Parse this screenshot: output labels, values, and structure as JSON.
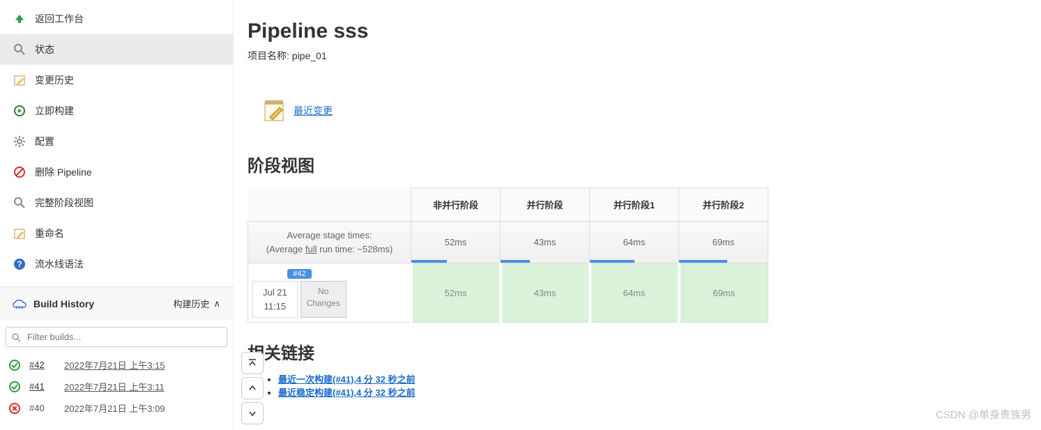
{
  "sidebar": {
    "items": [
      {
        "label": "返回工作台"
      },
      {
        "label": "状态"
      },
      {
        "label": "变更历史"
      },
      {
        "label": "立即构建"
      },
      {
        "label": "配置"
      },
      {
        "label": "删除 Pipeline"
      },
      {
        "label": "完整阶段视图"
      },
      {
        "label": "重命名"
      },
      {
        "label": "流水线语法"
      }
    ]
  },
  "buildHistory": {
    "title": "Build History",
    "trendLabel": "构建历史",
    "filterPlaceholder": "Filter builds...",
    "builds": [
      {
        "status": "success",
        "num": "#42",
        "date": "2022年7月21日 上午3:15"
      },
      {
        "status": "success",
        "num": "#41",
        "date": "2022年7月21日 上午3:11"
      },
      {
        "status": "fail",
        "num": "#40",
        "date": "2022年7月21日 上午3:09"
      }
    ]
  },
  "page": {
    "title": "Pipeline sss",
    "projectLabel": "项目名称: pipe_01",
    "recentChange": "最近变更",
    "stageTitle": "阶段视图",
    "relatedTitle": "相关链接"
  },
  "stages": {
    "headers": [
      "非并行阶段",
      "并行阶段",
      "并行阶段1",
      "并行阶段2"
    ],
    "avgLabel": "Average stage times:",
    "avgSub1": "(Average ",
    "avgSubFull": "full",
    "avgSub2": " run time: ~528ms)",
    "avgTimes": [
      "52ms",
      "43ms",
      "64ms",
      "69ms"
    ],
    "run": {
      "badge": "#42",
      "date1": "Jul 21",
      "date2": "11:15",
      "changes1": "No",
      "changes2": "Changes",
      "times": [
        "52ms",
        "43ms",
        "64ms",
        "69ms"
      ]
    }
  },
  "related": [
    "最近一次构建(#41),4 分 32 秒之前",
    "最近稳定构建(#41),4 分 32 秒之前"
  ],
  "watermark": "CSDN @单身贵族男"
}
